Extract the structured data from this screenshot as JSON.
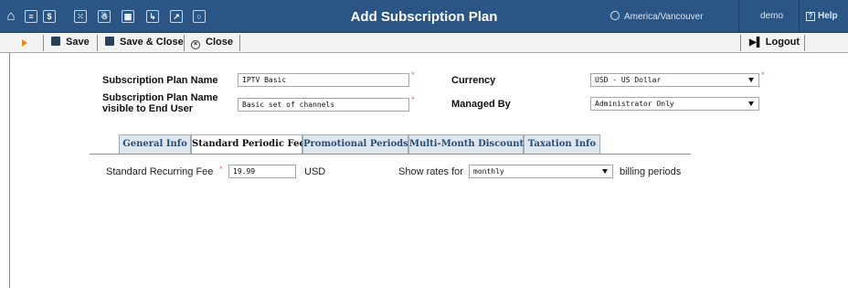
{
  "header": {
    "title": "Add Subscription Plan",
    "timezone": "America/Vancouver",
    "user": "demo",
    "help": "Help",
    "icons": [
      "home-icon",
      "list-icon",
      "dollar-icon",
      "grid-icon",
      "figure-icon",
      "panels-icon",
      "forward-icon",
      "chart-icon",
      "search-icon"
    ]
  },
  "toolbar": {
    "save": "Save",
    "save_close": "Save & Close",
    "close": "Close",
    "logout": "Logout"
  },
  "form": {
    "plan_name_label": "Subscription Plan Name",
    "plan_name_value": "IPTV Basic",
    "visible_name_label_1": "Subscription Plan Name",
    "visible_name_label_2": "visible to End User",
    "visible_name_value": "Basic set of channels",
    "currency_label": "Currency",
    "currency_value": "USD - US Dollar",
    "managed_by_label": "Managed By",
    "managed_by_value": "Administrator Only",
    "required_mark": "*"
  },
  "tabs": [
    {
      "label": "General Info",
      "active": false
    },
    {
      "label": "Standard Periodic Fee",
      "active": true
    },
    {
      "label": "Promotional Periods",
      "active": false
    },
    {
      "label": "Multi-Month Discounts",
      "active": false
    },
    {
      "label": "Taxation Info",
      "active": false
    }
  ],
  "periodic_fee": {
    "recurring_fee_label": "Standard Recurring Fee",
    "recurring_fee_value": "19.99",
    "currency": "USD",
    "show_rates_label": "Show rates for",
    "show_rates_value": "monthly",
    "billing_periods_label": "billing periods"
  },
  "colors": {
    "header_bg": "#2a5584",
    "toolbar_bg": "#f3f3f3",
    "tab_bg": "#dde5ee",
    "tab_text": "#2a4d78",
    "required": "#e06666",
    "arrow": "#e38a1a"
  }
}
